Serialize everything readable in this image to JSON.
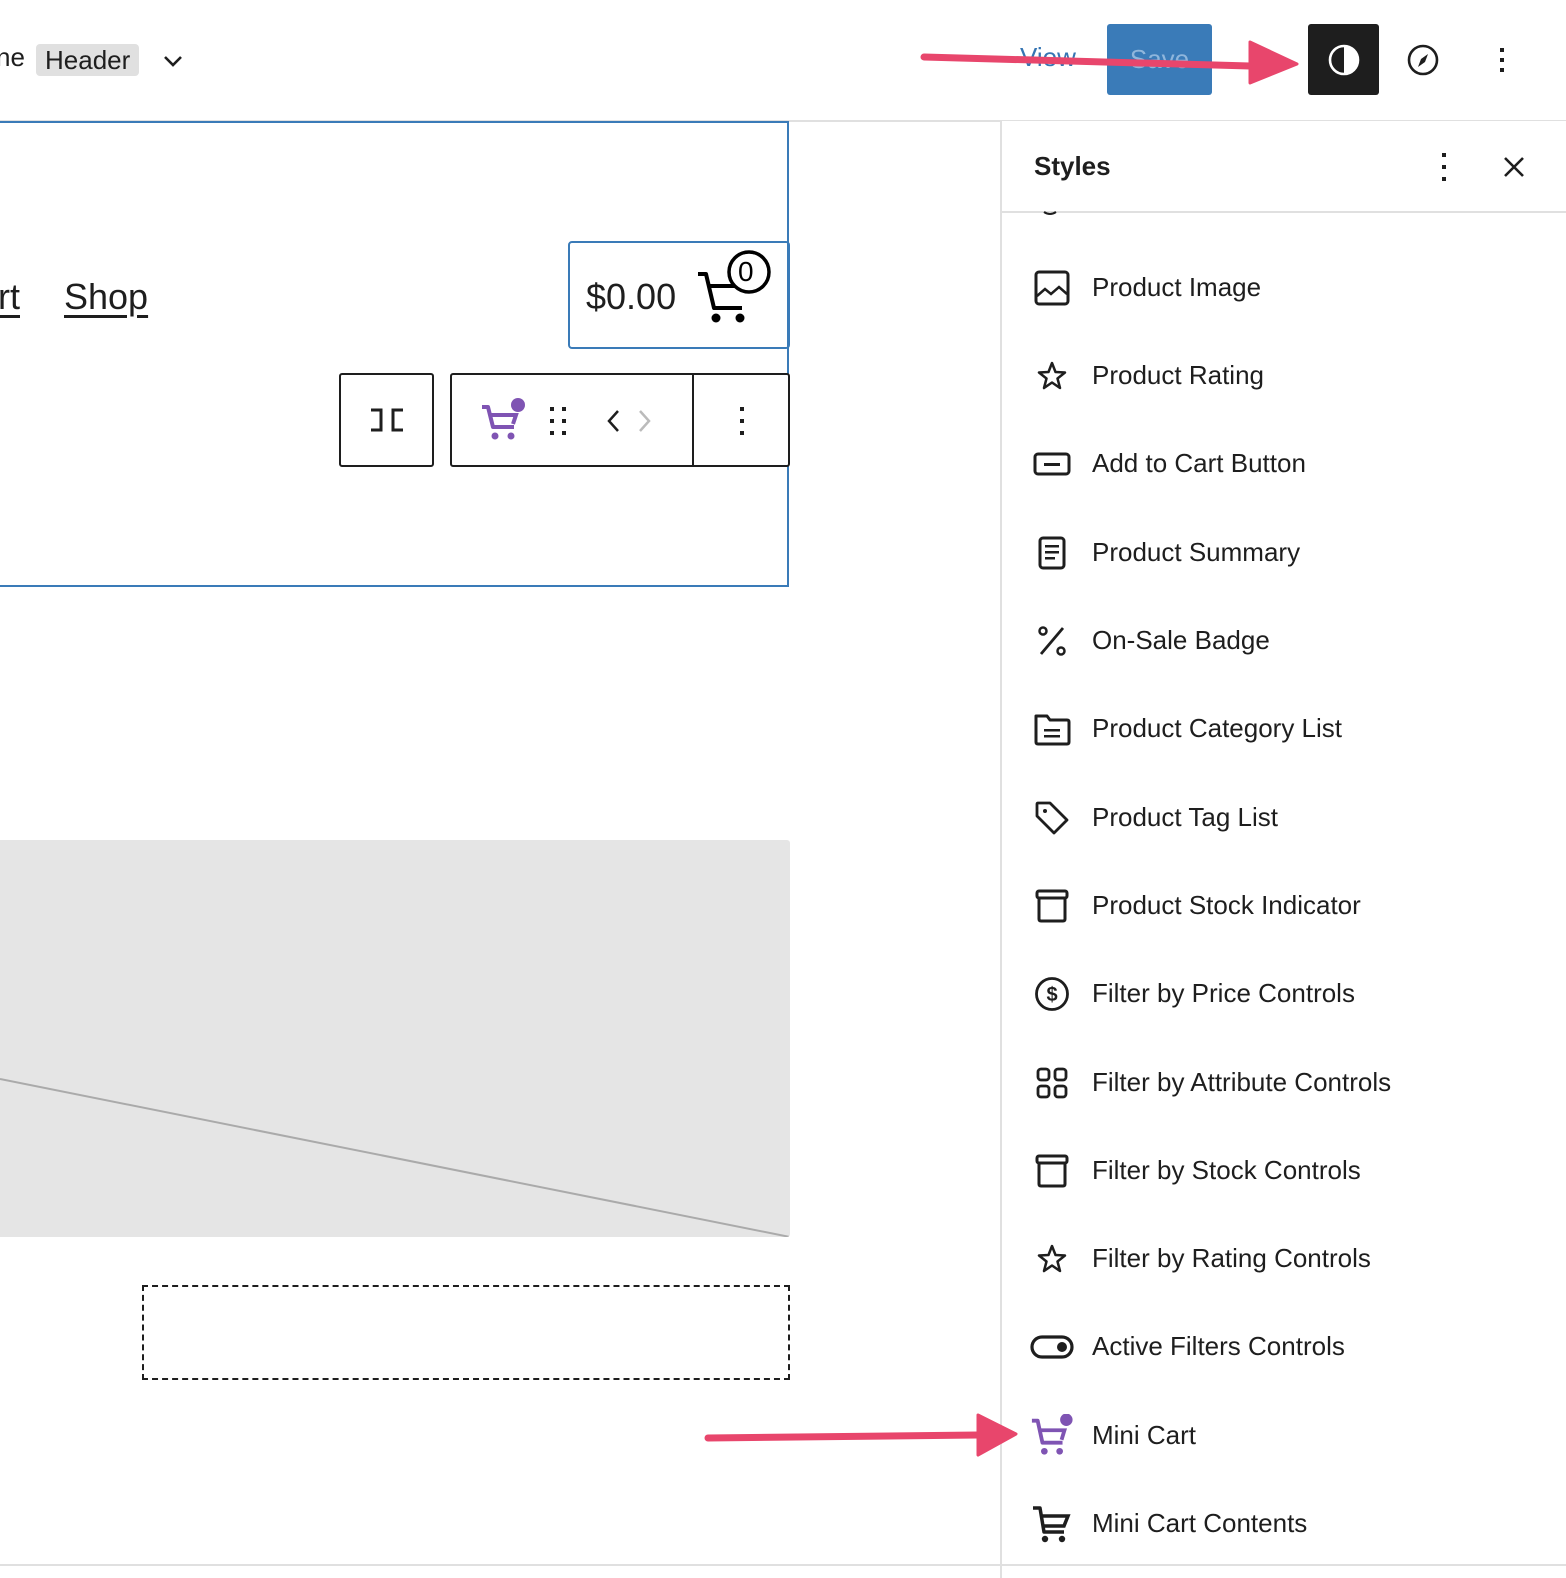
{
  "topbar": {
    "document_prefix": "ne",
    "document_tag": "Header",
    "view_label": "View",
    "save_label": "Save"
  },
  "canvas": {
    "nav_links": [
      "rt",
      "Shop"
    ],
    "mini_cart": {
      "amount": "$0.00",
      "count": "0"
    }
  },
  "sidebar": {
    "title": "Styles",
    "blocks": [
      {
        "label": "Product Image",
        "icon": "image-icon"
      },
      {
        "label": "Product Rating",
        "icon": "star-icon"
      },
      {
        "label": "Add to Cart Button",
        "icon": "button-icon"
      },
      {
        "label": "Product Summary",
        "icon": "document-icon"
      },
      {
        "label": "On-Sale Badge",
        "icon": "percent-icon"
      },
      {
        "label": "Product Category List",
        "icon": "folder-icon"
      },
      {
        "label": "Product Tag List",
        "icon": "tag-icon"
      },
      {
        "label": "Product Stock Indicator",
        "icon": "archive-box-icon"
      },
      {
        "label": "Filter by Price Controls",
        "icon": "dollar-circle-icon"
      },
      {
        "label": "Filter by Attribute Controls",
        "icon": "grid-icon"
      },
      {
        "label": "Filter by Stock Controls",
        "icon": "archive-box-icon"
      },
      {
        "label": "Filter by Rating Controls",
        "icon": "star-icon"
      },
      {
        "label": "Active Filters Controls",
        "icon": "toggle-icon"
      },
      {
        "label": "Mini Cart",
        "icon": "mini-cart-icon"
      },
      {
        "label": "Mini Cart Contents",
        "icon": "cart-icon"
      }
    ]
  },
  "colors": {
    "accent_blue": "#3a7bb8",
    "woo_purple": "#7f54b3",
    "annotation_arrow": "#e8466c",
    "dark": "#1e1e1e"
  }
}
